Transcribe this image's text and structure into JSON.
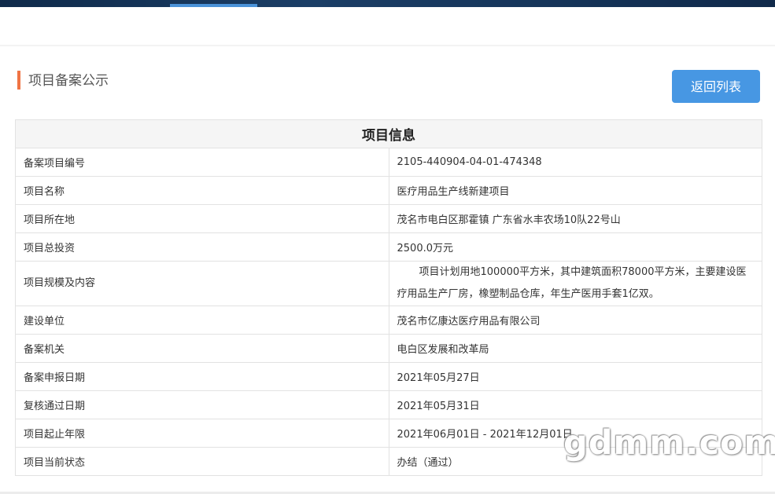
{
  "section_title": "项目备案公示",
  "back_button": "返回列表",
  "table": {
    "header": "项目信息",
    "rows": [
      {
        "label": "备案项目编号",
        "value": "2105-440904-04-01-474348"
      },
      {
        "label": "项目名称",
        "value": "医疗用品生产线新建项目"
      },
      {
        "label": "项目所在地",
        "value": "茂名市电白区那霍镇 广东省水丰农场10队22号山"
      },
      {
        "label": "项目总投资",
        "value": "2500.0万元"
      },
      {
        "label": "项目规模及内容",
        "value": "项目计划用地100000平方米，其中建筑面积78000平方米，主要建设医疗用品生产厂房，橡塑制品仓库，年生产医用手套1亿双。"
      },
      {
        "label": "建设单位",
        "value": "茂名市亿康达医疗用品有限公司"
      },
      {
        "label": "备案机关",
        "value": "电白区发展和改革局"
      },
      {
        "label": "备案申报日期",
        "value": "2021年05月27日"
      },
      {
        "label": "复核通过日期",
        "value": "2021年05月31日"
      },
      {
        "label": "项目起止年限",
        "value": "2021年06月01日 - 2021年12月01日"
      },
      {
        "label": "项目当前状态",
        "value": "办结（通过）"
      }
    ]
  },
  "watermark": "gdmm.com",
  "colors": {
    "accent_bar": "#f07444",
    "button": "#4797e3",
    "top_nav": "#16355a"
  }
}
